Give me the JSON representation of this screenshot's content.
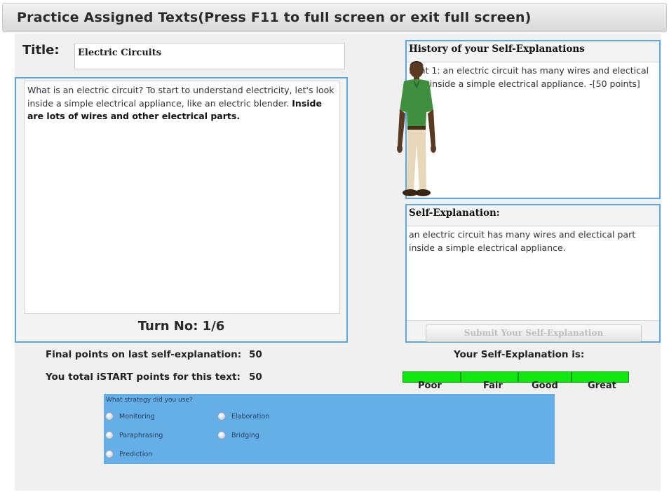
{
  "header": {
    "title": "Practice Assigned Texts(Press F11 to full screen or exit full screen)"
  },
  "title_field": {
    "label": "Title:",
    "value": "Electric Circuits"
  },
  "reading": {
    "text_normal": "What is an electric circuit? To start to understand electricity, let's look inside a simple electrical appliance, like an electric blender.",
    "text_bold": "Inside are lots of wires and other electrical parts.",
    "turn_label": "Turn No: 1/6"
  },
  "history": {
    "heading": "History of your Self-Explanations",
    "entry": "Sent 1: an electric circuit has  many wires and electical part inside a simple electrical appliance. -[50 points]"
  },
  "self_explanation": {
    "heading": "Self-Explanation:",
    "text": "an electric circuit has  many wires and electical part inside a simple electrical appliance.",
    "submit_label": "Submit Your Self-Explanation"
  },
  "points": {
    "final_label": "Final points on last self-explanation:",
    "final_value": "50",
    "total_label": "You total iSTART points for this text:",
    "total_value": "50"
  },
  "rating": {
    "label": "Your Self-Explanation is:",
    "levels": [
      "Poor",
      "Fair",
      "Good",
      "Great"
    ],
    "bar_color": "#10e610"
  },
  "strategy": {
    "question": "What strategy did you use?",
    "options": [
      "Monitoring",
      "Elaboration",
      "Paraphrasing",
      "Bridging",
      "Prediction"
    ]
  }
}
